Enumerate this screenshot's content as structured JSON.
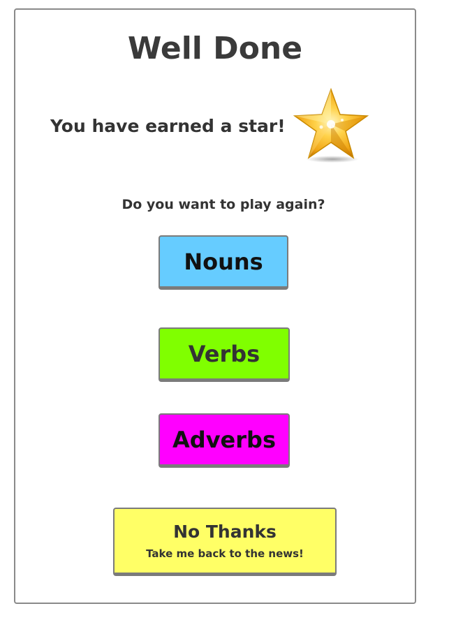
{
  "dialog": {
    "title": "Well Done",
    "earned_text": "You have earned a star!",
    "star_icon": "gold-star-icon",
    "play_again_text": "Do you want to play again?"
  },
  "buttons": {
    "nouns": {
      "label": "Nouns",
      "color": "#66ccff"
    },
    "verbs": {
      "label": "Verbs",
      "color": "#80ff00"
    },
    "adverbs": {
      "label": "Adverbs",
      "color": "#ff00ff"
    },
    "no_thanks": {
      "label": "No Thanks",
      "sub_label": "Take me back to the news!",
      "color": "#ffff66"
    }
  }
}
